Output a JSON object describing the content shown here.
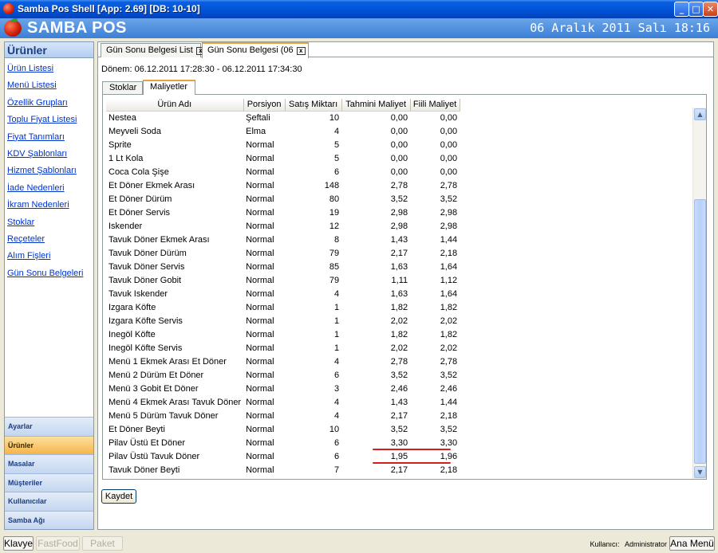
{
  "window": {
    "title": "Samba Pos Shell [App: 2.69] [DB: 10-10]",
    "min": "_",
    "max": "□",
    "close": "✕"
  },
  "header": {
    "brand": "SAMBA POS",
    "datetime": "06 Aralık 2011 Salı 18:16"
  },
  "sidebar": {
    "title": "Ürünler",
    "links": [
      "Ürün Listesi",
      "Menü Listesi",
      "Özellik Grupları",
      "Toplu Fiyat Listesi",
      "Fiyat Tanımları",
      "KDV Şablonları",
      "Hizmet Şablonları",
      "İade Nedenleri",
      "İkram Nedenleri",
      "Stoklar",
      "Reçeteler",
      "Alım Fişleri",
      "Gün Sonu Belgeleri"
    ],
    "sections": [
      "Ayarlar",
      "Ürünler",
      "Masalar",
      "Müşteriler",
      "Kullanıcılar",
      "Samba Ağı"
    ],
    "active_section": "Ürünler"
  },
  "doc_tabs": [
    {
      "label": "Gün Sonu Belgesi List",
      "close": "x",
      "active": false
    },
    {
      "label": "Gün Sonu Belgesi (06",
      "close": "x",
      "active": true
    }
  ],
  "period": "Dönem: 06.12.2011 17:28:30 - 06.12.2011 17:34:30",
  "inner_tabs": [
    "Stoklar",
    "Maliyetler"
  ],
  "table": {
    "columns": [
      "Ürün Adı",
      "Porsiyon",
      "Satış Miktarı",
      "Tahmini Maliyet",
      "Fiili Maliyet"
    ],
    "rows": [
      [
        "Nestea",
        "Şeftali",
        "10",
        "0,00",
        "0,00"
      ],
      [
        "Meyveli Soda",
        "Elma",
        "4",
        "0,00",
        "0,00"
      ],
      [
        "Sprite",
        "Normal",
        "5",
        "0,00",
        "0,00"
      ],
      [
        "1 Lt Kola",
        "Normal",
        "5",
        "0,00",
        "0,00"
      ],
      [
        "Coca Cola Şişe",
        "Normal",
        "6",
        "0,00",
        "0,00"
      ],
      [
        "Et Döner Ekmek Arası",
        "Normal",
        "148",
        "2,78",
        "2,78"
      ],
      [
        "Et Döner Dürüm",
        "Normal",
        "80",
        "3,52",
        "3,52"
      ],
      [
        "Et Döner Servis",
        "Normal",
        "19",
        "2,98",
        "2,98"
      ],
      [
        "Iskender",
        "Normal",
        "12",
        "2,98",
        "2,98"
      ],
      [
        "Tavuk Döner Ekmek Arası",
        "Normal",
        "8",
        "1,43",
        "1,44"
      ],
      [
        "Tavuk Döner Dürüm",
        "Normal",
        "79",
        "2,17",
        "2,18"
      ],
      [
        "Tavuk Döner Servis",
        "Normal",
        "85",
        "1,63",
        "1,64"
      ],
      [
        "Tavuk Döner Gobit",
        "Normal",
        "79",
        "1,11",
        "1,12"
      ],
      [
        "Tavuk Iskender",
        "Normal",
        "4",
        "1,63",
        "1,64"
      ],
      [
        "Izgara Köfte",
        "Normal",
        "1",
        "1,82",
        "1,82"
      ],
      [
        "Izgara Köfte Servis",
        "Normal",
        "1",
        "2,02",
        "2,02"
      ],
      [
        "Inegöl Köfte",
        "Normal",
        "1",
        "1,82",
        "1,82"
      ],
      [
        "Inegöl Köfte Servis",
        "Normal",
        "1",
        "2,02",
        "2,02"
      ],
      [
        "Menü 1 Ekmek Arası Et Döner",
        "Normal",
        "4",
        "2,78",
        "2,78"
      ],
      [
        "Menü 2 Dürüm Et Döner",
        "Normal",
        "6",
        "3,52",
        "3,52"
      ],
      [
        "Menü 3 Gobit Et Döner",
        "Normal",
        "3",
        "2,46",
        "2,46"
      ],
      [
        "Menü 4 Ekmek Arası Tavuk Döner",
        "Normal",
        "4",
        "1,43",
        "1,44"
      ],
      [
        "Menü 5 Dürüm Tavuk Döner",
        "Normal",
        "4",
        "2,17",
        "2,18"
      ],
      [
        "Et Döner Beyti",
        "Normal",
        "10",
        "3,52",
        "3,52"
      ],
      [
        "Pilav Üstü Et Döner",
        "Normal",
        "6",
        "3,30",
        "3,30"
      ],
      [
        "Pilav Üstü Tavuk Döner",
        "Normal",
        "6",
        "1,95",
        "1,96"
      ],
      [
        "Tavuk Döner Beyti",
        "Normal",
        "7",
        "2,17",
        "2,18"
      ]
    ]
  },
  "save_button": "Kaydet",
  "statusbar": {
    "buttons": [
      {
        "label": "Klavye",
        "enabled": true
      },
      {
        "label": "FastFood",
        "enabled": false
      },
      {
        "label": "Paket",
        "enabled": false
      }
    ],
    "user_label": "Kullanıcı:",
    "user_name": "Administrator",
    "home_button": "Ana Menü"
  },
  "colors": {
    "title_bar": "#0355d8",
    "header": "#3c7fd6",
    "active_section": "#f6b44a",
    "annotation": "#d21e1e",
    "link": "#0033cc"
  }
}
